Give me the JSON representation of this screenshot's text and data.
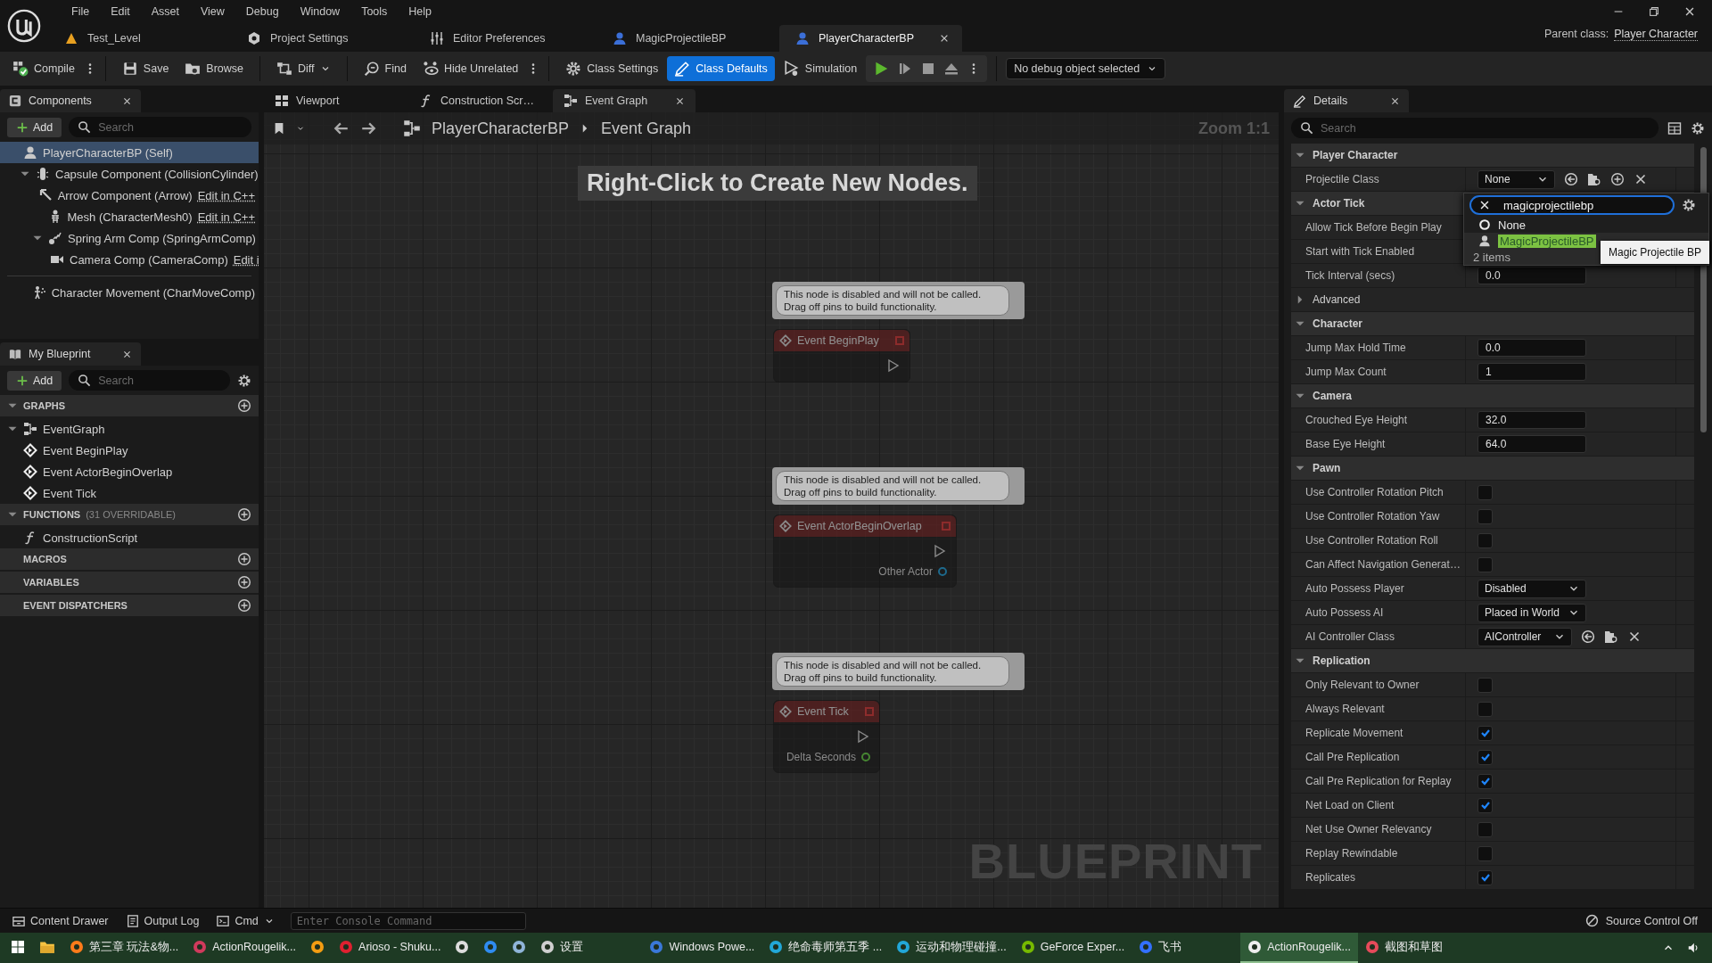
{
  "menu": [
    "File",
    "Edit",
    "Asset",
    "View",
    "Debug",
    "Window",
    "Tools",
    "Help"
  ],
  "doc_tabs": [
    {
      "label": "Test_Level",
      "kind": "level",
      "selected": false
    },
    {
      "label": "Project Settings",
      "kind": "settings",
      "selected": false
    },
    {
      "label": "Editor Preferences",
      "kind": "prefs",
      "selected": false
    },
    {
      "label": "MagicProjectileBP",
      "kind": "blueprint",
      "selected": false
    },
    {
      "label": "PlayerCharacterBP",
      "kind": "blueprint",
      "selected": true
    }
  ],
  "parent_class": {
    "label": "Parent class:",
    "value": "Player Character"
  },
  "toolbar": [
    {
      "label": "Compile",
      "kind": "compile",
      "selected": false
    },
    {
      "label": "Save",
      "kind": "save",
      "selected": false
    },
    {
      "label": "Browse",
      "kind": "browse",
      "selected": false
    },
    {
      "label": "Diff",
      "kind": "diff",
      "selected": false
    },
    {
      "label": "Find",
      "kind": "find",
      "selected": false
    },
    {
      "label": "Hide Unrelated",
      "kind": "hide",
      "selected": false
    },
    {
      "label": "Class Settings",
      "kind": "class-settings",
      "selected": false
    },
    {
      "label": "Class Defaults",
      "kind": "class-defaults",
      "selected": true
    },
    {
      "label": "Simulation",
      "kind": "simulation",
      "selected": false
    }
  ],
  "debug_selector": "No debug object selected",
  "components": {
    "title": "Components",
    "add": "Add",
    "search_placeholder": "Search",
    "tree": [
      {
        "label": "PlayerCharacterBP (Self)",
        "kind": "self",
        "selected": true,
        "children": [
          {
            "label": "Capsule Component (CollisionCylinder)",
            "kind": "capsule",
            "selected": false,
            "expanded": true,
            "children": [
              {
                "label": "Arrow Component (Arrow)",
                "kind": "arrow",
                "selected": false,
                "link": "Edit in C++"
              },
              {
                "label": "Mesh (CharacterMesh0)",
                "kind": "mesh",
                "selected": false,
                "link": "Edit in C++"
              },
              {
                "label": "Spring Arm Comp (SpringArmComp)",
                "kind": "spring",
                "selected": false,
                "expanded": true,
                "children": [
                  {
                    "label": "Camera Comp (CameraComp)",
                    "kind": "camera",
                    "selected": false,
                    "link": "Edit i"
                  }
                ]
              }
            ]
          }
        ]
      }
    ],
    "extra": [
      {
        "label": "Character Movement (CharMoveComp)",
        "kind": "movement",
        "selected": false
      }
    ]
  },
  "my_blueprint": {
    "title": "My Blueprint",
    "add": "Add",
    "search_placeholder": "Search",
    "sections": [
      {
        "title": "GRAPHS",
        "expanded": true,
        "items": [
          {
            "label": "EventGraph",
            "kind": "graph",
            "expanded": true,
            "children": [
              {
                "label": "Event BeginPlay",
                "kind": "event"
              },
              {
                "label": "Event ActorBeginOverlap",
                "kind": "event"
              },
              {
                "label": "Event Tick",
                "kind": "event"
              }
            ]
          }
        ]
      },
      {
        "title": "FUNCTIONS",
        "note": "(31 OVERRIDABLE)",
        "expanded": true,
        "items": [
          {
            "label": "ConstructionScript",
            "kind": "function"
          }
        ]
      },
      {
        "title": "MACROS"
      },
      {
        "title": "VARIABLES"
      },
      {
        "title": "EVENT DISPATCHERS"
      }
    ]
  },
  "editor": {
    "tabs": [
      {
        "label": "Viewport",
        "kind": "viewport",
        "selected": false
      },
      {
        "label": "Construction Scr…",
        "kind": "function",
        "selected": false
      },
      {
        "label": "Event Graph",
        "kind": "graph",
        "selected": true
      }
    ],
    "breadcrumb": [
      "PlayerCharacterBP",
      "Event Graph"
    ],
    "zoom": "Zoom 1:1",
    "hint": "Right-Click to Create New Nodes.",
    "nodes": [
      {
        "comment": "This node is disabled and will not be called.\nDrag off pins to build functionality.",
        "title": "Event BeginPlay",
        "disabled": true
      },
      {
        "comment": "This node is disabled and will not be called.\nDrag off pins to build functionality.",
        "title": "Event ActorBeginOverlap",
        "disabled": true,
        "pins": [
          {
            "label": "Other Actor",
            "kind": "object"
          }
        ]
      },
      {
        "comment": "This node is disabled and will not be called.\nDrag off pins to build functionality.",
        "title": "Event Tick",
        "disabled": true,
        "pins": [
          {
            "label": "Delta Seconds",
            "kind": "float"
          }
        ]
      }
    ],
    "watermark": "BLUEPRINT"
  },
  "details": {
    "title": "Details",
    "search_placeholder": "Search",
    "sections": [
      {
        "title": "Player Character",
        "expanded": true,
        "rows": [
          {
            "label": "Projectile Class",
            "kind": "class-new",
            "value": "None"
          }
        ]
      },
      {
        "title": "Actor Tick",
        "expanded": true,
        "rows": [
          {
            "label": "Allow Tick Before Begin Play"
          },
          {
            "label": "Start with Tick Enabled"
          },
          {
            "label": "Tick Interval (secs)",
            "kind": "number",
            "value": "0.0"
          }
        ]
      },
      {
        "title": "Advanced",
        "expanded": false
      },
      {
        "title": "Character",
        "expanded": true,
        "rows": [
          {
            "label": "Jump Max Hold Time",
            "kind": "number",
            "value": "0.0"
          },
          {
            "label": "Jump Max Count",
            "kind": "number",
            "value": "1"
          }
        ]
      },
      {
        "title": "Camera",
        "expanded": true,
        "rows": [
          {
            "label": "Crouched Eye Height",
            "kind": "number",
            "value": "32.0"
          },
          {
            "label": "Base Eye Height",
            "kind": "number",
            "value": "64.0"
          }
        ]
      },
      {
        "title": "Pawn",
        "expanded": true,
        "rows": [
          {
            "label": "Use Controller Rotation Pitch",
            "kind": "checkbox",
            "checked": false
          },
          {
            "label": "Use Controller Rotation Yaw",
            "kind": "checkbox",
            "checked": false
          },
          {
            "label": "Use Controller Rotation Roll",
            "kind": "checkbox",
            "checked": false
          },
          {
            "label": "Can Affect Navigation Generat…",
            "kind": "checkbox",
            "checked": false
          },
          {
            "label": "Auto Possess Player",
            "kind": "dropdown",
            "value": "Disabled"
          },
          {
            "label": "Auto Possess AI",
            "kind": "dropdown",
            "value": "Placed in World"
          },
          {
            "label": "AI Controller Class",
            "kind": "class",
            "value": "AIController"
          }
        ]
      },
      {
        "title": "Replication",
        "expanded": true,
        "rows": [
          {
            "label": "Only Relevant to Owner",
            "kind": "checkbox",
            "checked": false
          },
          {
            "label": "Always Relevant",
            "kind": "checkbox",
            "checked": false
          },
          {
            "label": "Replicate Movement",
            "kind": "checkbox",
            "checked": true
          },
          {
            "label": "Call Pre Replication",
            "kind": "checkbox",
            "checked": true
          },
          {
            "label": "Call Pre Replication for Replay",
            "kind": "checkbox",
            "checked": true
          },
          {
            "label": "Net Load on Client",
            "kind": "checkbox",
            "checked": true
          },
          {
            "label": "Net Use Owner Relevancy",
            "kind": "checkbox",
            "checked": false
          },
          {
            "label": "Replay Rewindable",
            "kind": "checkbox",
            "checked": false
          },
          {
            "label": "Replicates",
            "kind": "checkbox",
            "checked": true
          }
        ]
      }
    ]
  },
  "picker": {
    "search_value": "magicprojectilebp",
    "options": [
      {
        "label": "None",
        "kind": "none",
        "selected": false
      },
      {
        "label": "MagicProjectileBP",
        "kind": "asset",
        "selected": true
      }
    ],
    "count": "2 items",
    "tooltip": "Magic Projectile BP"
  },
  "bottom_bar": {
    "buttons": [
      {
        "label": "Content Drawer",
        "kind": "drawer"
      },
      {
        "label": "Output Log",
        "kind": "log"
      },
      {
        "label": "Cmd",
        "kind": "cmd"
      }
    ],
    "console_placeholder": "Enter Console Command",
    "source_control": "Source Control Off"
  },
  "taskbar": {
    "items": [
      {
        "label": "第三章 玩法&物...",
        "color": "#ff7b1a",
        "selected": false
      },
      {
        "label": "ActionRougelik...",
        "color": "#d03a5c",
        "selected": false
      },
      {
        "color": "#f39c12",
        "selected": false
      },
      {
        "label": "Arioso - Shuku...",
        "color": "#e02030",
        "selected": false
      },
      {
        "color": "#dddddd",
        "selected": false
      },
      {
        "color": "#2f8cf0",
        "selected": false
      },
      {
        "color": "#8fb4d8",
        "selected": false
      },
      {
        "label": "设置",
        "color": "#cfcfcf",
        "selected": false
      },
      {
        "label": "Windows Powe...",
        "color": "#3a78d8",
        "selected": false
      },
      {
        "label": "绝命毒师第五季 ...",
        "color": "#22a7d8",
        "selected": false
      },
      {
        "label": "运动和物理碰撞...",
        "color": "#22a7d8",
        "selected": false
      },
      {
        "label": "GeForce Exper...",
        "color": "#76b900",
        "selected": false
      },
      {
        "label": "飞书",
        "color": "#3370ff",
        "selected": false
      },
      {
        "label": "ActionRougelik...",
        "color": "#eeeeee",
        "selected": true
      },
      {
        "label": "截图和草图",
        "color": "#e64a5a",
        "selected": false
      }
    ]
  }
}
